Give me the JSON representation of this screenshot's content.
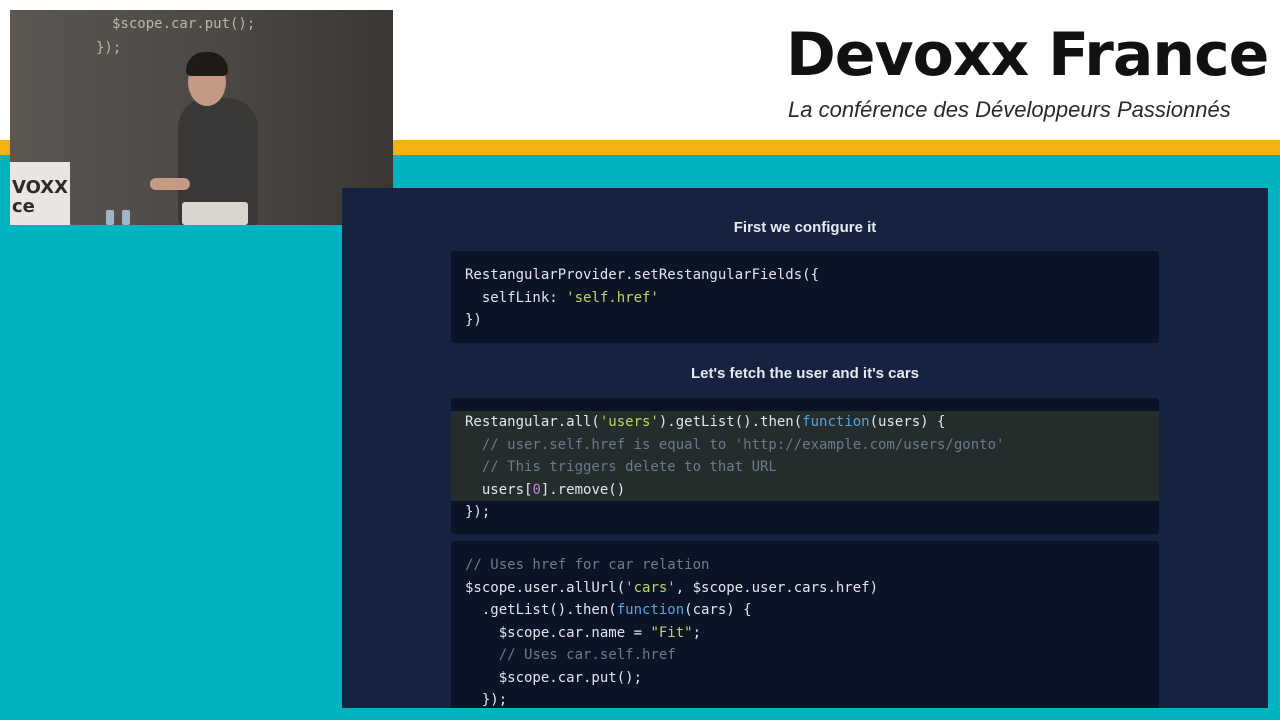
{
  "branding": {
    "title": "Devoxx France",
    "subtitle": "La conférence des Développeurs Passionnés"
  },
  "colors": {
    "stripe": "#f5b111",
    "teal": "#00b3c0",
    "slide_bg": "#162340",
    "code_bg": "#0b1427",
    "string": "#c3d55b",
    "keyword": "#4fa6e0",
    "comment": "#6b7a8c"
  },
  "video": {
    "code_lines": [
      "$scope.car.put();",
      "});"
    ],
    "banner_text": "VOXX\nce"
  },
  "slide": {
    "heading1": "First we configure it",
    "heading2": "Let's fetch the user and it's cars",
    "block1": [
      [
        {
          "t": "RestangularProvider.setRestangularFields({",
          "c": ""
        }
      ],
      [
        {
          "t": "  selfLink: ",
          "c": ""
        },
        {
          "t": "'self.href'",
          "c": "str"
        }
      ],
      [
        {
          "t": "})",
          "c": ""
        }
      ]
    ],
    "block2": [
      [
        {
          "t": "Restangular.all(",
          "c": ""
        },
        {
          "t": "'users'",
          "c": "str"
        },
        {
          "t": ").getList().then(",
          "c": ""
        },
        {
          "t": "function",
          "c": "kw"
        },
        {
          "t": "(users) {",
          "c": ""
        }
      ],
      [
        {
          "t": "  // user.self.href is equal to 'http://example.com/users/gonto'",
          "c": "cm"
        }
      ],
      [
        {
          "t": "  // This triggers delete to that URL",
          "c": "cm"
        }
      ],
      [
        {
          "t": "  users[",
          "c": ""
        },
        {
          "t": "0",
          "c": "num"
        },
        {
          "t": "].remove()",
          "c": ""
        }
      ],
      [
        {
          "t": "});",
          "c": ""
        }
      ]
    ],
    "block2_highlight": [
      0,
      1,
      2,
      3
    ],
    "block3": [
      [
        {
          "t": "// Uses href for car relation",
          "c": "cm"
        }
      ],
      [
        {
          "t": "$scope.user.allUrl(",
          "c": ""
        },
        {
          "t": "'cars'",
          "c": "str"
        },
        {
          "t": ", $scope.user.cars.href)",
          "c": ""
        }
      ],
      [
        {
          "t": "  .getList().then(",
          "c": ""
        },
        {
          "t": "function",
          "c": "kw"
        },
        {
          "t": "(cars) {",
          "c": ""
        }
      ],
      [
        {
          "t": "    $scope.car.name = ",
          "c": ""
        },
        {
          "t": "\"Fit\"",
          "c": "str"
        },
        {
          "t": ";",
          "c": ""
        }
      ],
      [
        {
          "t": "    // Uses car.self.href",
          "c": "cm"
        }
      ],
      [
        {
          "t": "    $scope.car.put();",
          "c": ""
        }
      ],
      [
        {
          "t": "  });",
          "c": ""
        }
      ]
    ]
  }
}
